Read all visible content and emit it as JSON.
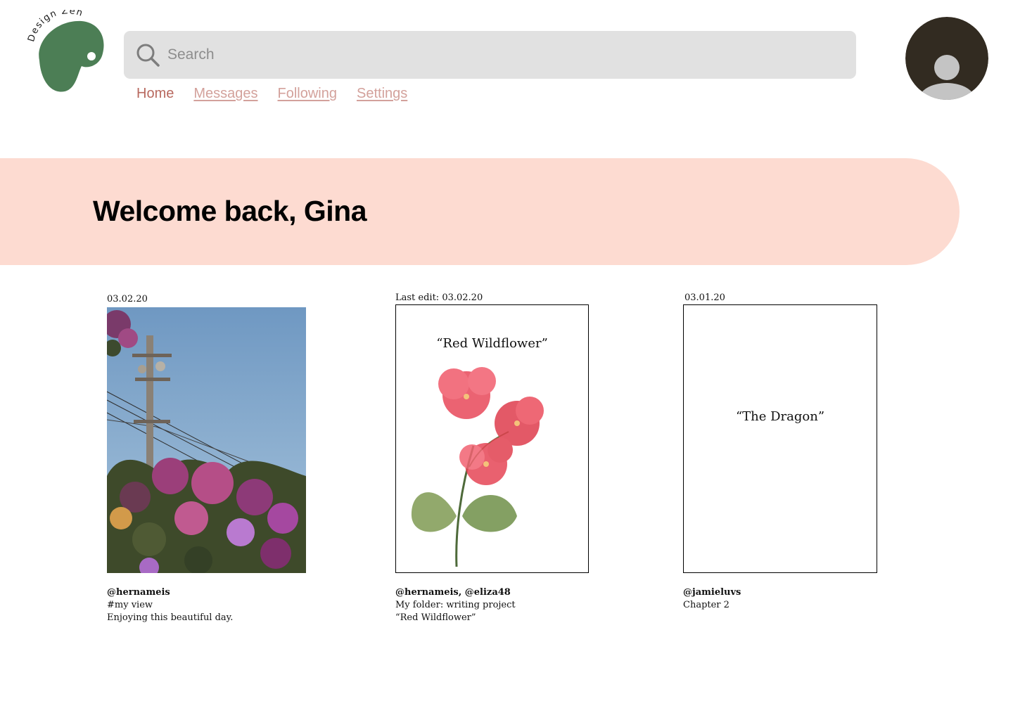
{
  "app": {
    "logo_text": "Design Zen",
    "logo_color": "#4c7e55"
  },
  "search": {
    "placeholder": "Search",
    "icon": "search-icon"
  },
  "nav": {
    "items": [
      {
        "label": "Home",
        "active": true
      },
      {
        "label": "Messages",
        "active": false
      },
      {
        "label": "Following",
        "active": false
      },
      {
        "label": "Settings",
        "active": false
      }
    ]
  },
  "user": {
    "avatar_icon": "user-avatar-icon"
  },
  "banner": {
    "title": "Welcome back, Gina",
    "color": "#fddbd1"
  },
  "cards": [
    {
      "date": "03.02.20",
      "users": "@hernameis",
      "lines": [
        "#my view",
        "Enjoying this beautiful day."
      ]
    },
    {
      "date": "Last edit: 03.02.20",
      "frame_title": "“Red Wildflower”",
      "users": "@hernameis, @eliza48",
      "lines": [
        "My folder: writing project",
        "“Red Wildflower”"
      ]
    },
    {
      "date": "03.01.20",
      "frame_title": "“The Dragon”",
      "users": "@jamieluvs",
      "lines": [
        "Chapter 2"
      ]
    }
  ],
  "colors": {
    "nav_active": "#b8695f",
    "nav_link": "#d3a19b",
    "search_bg": "#e1e1e1"
  }
}
